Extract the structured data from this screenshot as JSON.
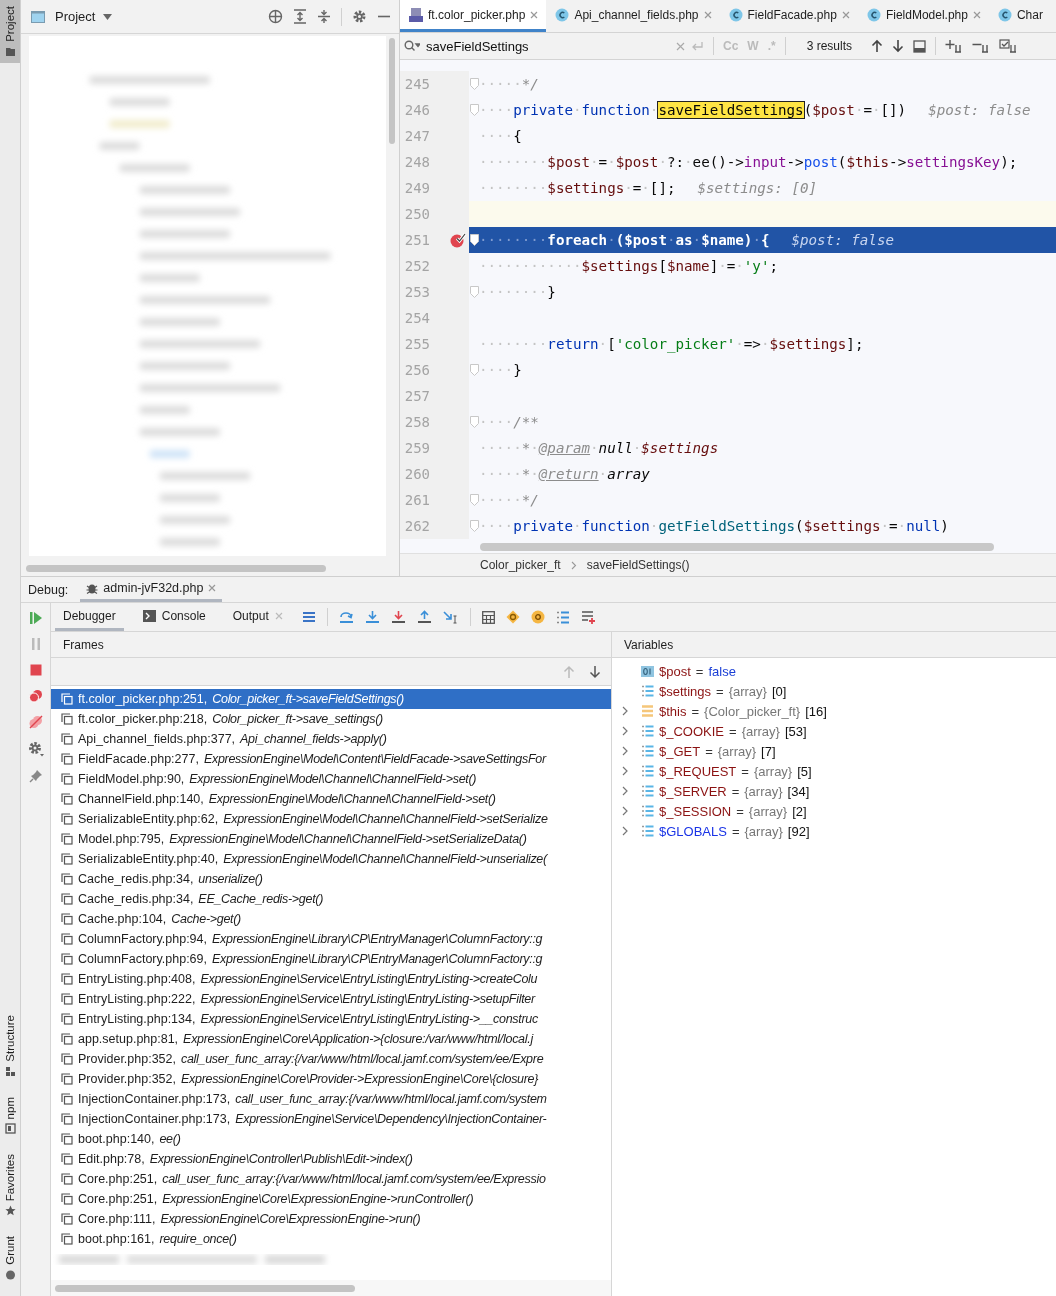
{
  "tool_strip": {
    "top": [
      {
        "label": "Project",
        "selected": true
      }
    ],
    "bottom": [
      {
        "label": "Structure",
        "kind": "structure"
      },
      {
        "label": "npm",
        "kind": "npm"
      },
      {
        "label": "Favorites",
        "kind": "star"
      },
      {
        "label": "Grunt",
        "kind": "grunt"
      }
    ]
  },
  "project_panel": {
    "title": "Project"
  },
  "editor_tabs": [
    {
      "label": "ft.color_picker.php",
      "kind": "php",
      "selected": true,
      "closable": true
    },
    {
      "label": "Api_channel_fields.php",
      "kind": "class",
      "selected": false,
      "closable": true
    },
    {
      "label": "FieldFacade.php",
      "kind": "class",
      "selected": false,
      "closable": true
    },
    {
      "label": "FieldModel.php",
      "kind": "class",
      "selected": false,
      "closable": true
    },
    {
      "label": "Char",
      "kind": "class",
      "selected": false,
      "closable": false
    }
  ],
  "search": {
    "value": "saveFieldSettings",
    "toggles": [
      "Cc",
      "W",
      ".*"
    ],
    "results": "3 results"
  },
  "code_lines": [
    {
      "number": "245",
      "fold": true,
      "current": false,
      "executing": false,
      "breakpoint": false,
      "tokens": [
        {
          "kind": "ws",
          "text": "·····"
        },
        {
          "kind": "comment",
          "text": "*/"
        }
      ]
    },
    {
      "number": "246",
      "fold": true,
      "current": false,
      "executing": false,
      "breakpoint": false,
      "tokens": [
        {
          "kind": "ws",
          "text": "····"
        },
        {
          "kind": "kw",
          "text": "private"
        },
        {
          "kind": "ws",
          "text": "·"
        },
        {
          "kind": "kw",
          "text": "function"
        },
        {
          "kind": "ws",
          "text": "·"
        },
        {
          "kind": "match",
          "text": "saveFieldSettings"
        },
        {
          "kind": "plain",
          "text": "("
        },
        {
          "kind": "var",
          "text": "$post"
        },
        {
          "kind": "ws",
          "text": "·"
        },
        {
          "kind": "plain",
          "text": "="
        },
        {
          "kind": "ws",
          "text": "·"
        },
        {
          "kind": "plain",
          "text": "[])"
        },
        {
          "kind": "hint",
          "text": "$post: false"
        }
      ]
    },
    {
      "number": "247",
      "fold": false,
      "current": false,
      "executing": false,
      "breakpoint": false,
      "tokens": [
        {
          "kind": "ws",
          "text": "····"
        },
        {
          "kind": "plain",
          "text": "{"
        }
      ]
    },
    {
      "number": "248",
      "fold": false,
      "current": false,
      "executing": false,
      "breakpoint": false,
      "tokens": [
        {
          "kind": "ws",
          "text": "········"
        },
        {
          "kind": "var",
          "text": "$post"
        },
        {
          "kind": "ws",
          "text": "·"
        },
        {
          "kind": "plain",
          "text": "="
        },
        {
          "kind": "ws",
          "text": "·"
        },
        {
          "kind": "var",
          "text": "$post"
        },
        {
          "kind": "ws",
          "text": "·"
        },
        {
          "kind": "plain",
          "text": "?:"
        },
        {
          "kind": "ws",
          "text": "·"
        },
        {
          "kind": "plain",
          "text": "ee()->"
        },
        {
          "kind": "prop",
          "text": "input"
        },
        {
          "kind": "plain",
          "text": "->"
        },
        {
          "kind": "call",
          "text": "post"
        },
        {
          "kind": "plain",
          "text": "("
        },
        {
          "kind": "var",
          "text": "$this"
        },
        {
          "kind": "plain",
          "text": "->"
        },
        {
          "kind": "prop",
          "text": "settingsKey"
        },
        {
          "kind": "plain",
          "text": ");"
        }
      ]
    },
    {
      "number": "249",
      "fold": false,
      "current": false,
      "executing": false,
      "breakpoint": false,
      "tokens": [
        {
          "kind": "ws",
          "text": "········"
        },
        {
          "kind": "var",
          "text": "$settings"
        },
        {
          "kind": "ws",
          "text": "·"
        },
        {
          "kind": "plain",
          "text": "="
        },
        {
          "kind": "ws",
          "text": "·"
        },
        {
          "kind": "plain",
          "text": "[];"
        },
        {
          "kind": "hint",
          "text": "$settings: [0]"
        }
      ]
    },
    {
      "number": "250",
      "fold": false,
      "current": true,
      "executing": false,
      "breakpoint": false
    },
    {
      "number": "251",
      "fold": true,
      "current": false,
      "executing": true,
      "breakpoint": true,
      "tokens": [
        {
          "kind": "ws",
          "text": "········"
        },
        {
          "kind": "kw",
          "text": "foreach"
        },
        {
          "kind": "ws",
          "text": "·"
        },
        {
          "kind": "plain",
          "text": "("
        },
        {
          "kind": "var",
          "text": "$post"
        },
        {
          "kind": "ws",
          "text": "·"
        },
        {
          "kind": "kw",
          "text": "as"
        },
        {
          "kind": "ws",
          "text": "·"
        },
        {
          "kind": "var",
          "text": "$name"
        },
        {
          "kind": "plain",
          "text": ")"
        },
        {
          "kind": "ws",
          "text": "·"
        },
        {
          "kind": "plain",
          "text": "{"
        },
        {
          "kind": "hint",
          "text": "$post: false"
        }
      ]
    },
    {
      "number": "252",
      "fold": false,
      "current": false,
      "executing": false,
      "breakpoint": false,
      "tokens": [
        {
          "kind": "ws",
          "text": "············"
        },
        {
          "kind": "var",
          "text": "$settings"
        },
        {
          "kind": "plain",
          "text": "["
        },
        {
          "kind": "var",
          "text": "$name"
        },
        {
          "kind": "plain",
          "text": "]"
        },
        {
          "kind": "ws",
          "text": "·"
        },
        {
          "kind": "plain",
          "text": "="
        },
        {
          "kind": "ws",
          "text": "·"
        },
        {
          "kind": "str",
          "text": "'y'"
        },
        {
          "kind": "plain",
          "text": ";"
        }
      ]
    },
    {
      "number": "253",
      "fold": true,
      "current": false,
      "executing": false,
      "breakpoint": false,
      "tokens": [
        {
          "kind": "ws",
          "text": "········"
        },
        {
          "kind": "plain",
          "text": "}"
        }
      ]
    },
    {
      "number": "254",
      "fold": false,
      "current": false,
      "executing": false,
      "breakpoint": false
    },
    {
      "number": "255",
      "fold": false,
      "current": false,
      "executing": false,
      "breakpoint": false,
      "tokens": [
        {
          "kind": "ws",
          "text": "········"
        },
        {
          "kind": "kw",
          "text": "return"
        },
        {
          "kind": "ws",
          "text": "·"
        },
        {
          "kind": "plain",
          "text": "["
        },
        {
          "kind": "str",
          "text": "'color_picker'"
        },
        {
          "kind": "ws",
          "text": "·"
        },
        {
          "kind": "plain",
          "text": "=>"
        },
        {
          "kind": "ws",
          "text": "·"
        },
        {
          "kind": "var",
          "text": "$settings"
        },
        {
          "kind": "plain",
          "text": "];"
        }
      ]
    },
    {
      "number": "256",
      "fold": true,
      "current": false,
      "executing": false,
      "breakpoint": false,
      "tokens": [
        {
          "kind": "ws",
          "text": "····"
        },
        {
          "kind": "plain",
          "text": "}"
        }
      ]
    },
    {
      "number": "257",
      "fold": false,
      "current": false,
      "executing": false,
      "breakpoint": false
    },
    {
      "number": "258",
      "fold": true,
      "current": false,
      "executing": false,
      "breakpoint": false,
      "tokens": [
        {
          "kind": "ws",
          "text": "····"
        },
        {
          "kind": "comment",
          "text": "/**"
        }
      ]
    },
    {
      "number": "259",
      "fold": false,
      "current": false,
      "executing": false,
      "breakpoint": false,
      "tokens": [
        {
          "kind": "ws",
          "text": "·····"
        },
        {
          "kind": "comment",
          "text": "*"
        },
        {
          "kind": "ws",
          "text": "·"
        },
        {
          "kind": "doctag",
          "text": "@param"
        },
        {
          "kind": "ws",
          "text": "·"
        },
        {
          "kind": "doctype",
          "text": "null"
        },
        {
          "kind": "ws",
          "text": "·"
        },
        {
          "kind": "docvar",
          "text": "$settings"
        }
      ]
    },
    {
      "number": "260",
      "fold": false,
      "current": false,
      "executing": false,
      "breakpoint": false,
      "tokens": [
        {
          "kind": "ws",
          "text": "·····"
        },
        {
          "kind": "comment",
          "text": "*"
        },
        {
          "kind": "ws",
          "text": "·"
        },
        {
          "kind": "doctag",
          "text": "@return"
        },
        {
          "kind": "ws",
          "text": "·"
        },
        {
          "kind": "doctype",
          "text": "array"
        }
      ]
    },
    {
      "number": "261",
      "fold": true,
      "current": false,
      "executing": false,
      "breakpoint": false,
      "tokens": [
        {
          "kind": "ws",
          "text": "·····"
        },
        {
          "kind": "comment",
          "text": "*/"
        }
      ]
    },
    {
      "number": "262",
      "fold": true,
      "current": false,
      "executing": false,
      "breakpoint": false,
      "tokens": [
        {
          "kind": "ws",
          "text": "····"
        },
        {
          "kind": "kw",
          "text": "private"
        },
        {
          "kind": "ws",
          "text": "·"
        },
        {
          "kind": "kw",
          "text": "function"
        },
        {
          "kind": "ws",
          "text": "·"
        },
        {
          "kind": "fn",
          "text": "getFieldSettings"
        },
        {
          "kind": "plain",
          "text": "("
        },
        {
          "kind": "var",
          "text": "$settings"
        },
        {
          "kind": "ws",
          "text": "·"
        },
        {
          "kind": "plain",
          "text": "="
        },
        {
          "kind": "ws",
          "text": "·"
        },
        {
          "kind": "kw",
          "text": "null"
        },
        {
          "kind": "plain",
          "text": ")"
        }
      ]
    }
  ],
  "breadcrumbs": [
    "Color_picker_ft",
    "saveFieldSettings()"
  ],
  "debug": {
    "label": "Debug:",
    "session": "admin-jvF32d.php",
    "tabs": [
      {
        "label": "Debugger",
        "kind": "plain",
        "selected": true,
        "closable": false
      },
      {
        "label": "Console",
        "kind": "console",
        "selected": false,
        "closable": false
      },
      {
        "label": "Output",
        "kind": "plain",
        "selected": false,
        "closable": true
      }
    ]
  },
  "frames": {
    "title": "Frames",
    "rows": [
      {
        "file": "ft.color_picker.php:251,",
        "method": "Color_picker_ft->saveFieldSettings()",
        "selected": true
      },
      {
        "file": "ft.color_picker.php:218,",
        "method": "Color_picker_ft->save_settings()",
        "selected": false
      },
      {
        "file": "Api_channel_fields.php:377,",
        "method": "Api_channel_fields->apply()",
        "selected": false
      },
      {
        "file": "FieldFacade.php:277,",
        "method": "ExpressionEngine\\Model\\Content\\FieldFacade->saveSettingsFor",
        "selected": false
      },
      {
        "file": "FieldModel.php:90,",
        "method": "ExpressionEngine\\Model\\Channel\\ChannelField->set()",
        "selected": false
      },
      {
        "file": "ChannelField.php:140,",
        "method": "ExpressionEngine\\Model\\Channel\\ChannelField->set()",
        "selected": false
      },
      {
        "file": "SerializableEntity.php:62,",
        "method": "ExpressionEngine\\Model\\Channel\\ChannelField->setSerialize",
        "selected": false
      },
      {
        "file": "Model.php:795,",
        "method": "ExpressionEngine\\Model\\Channel\\ChannelField->setSerializeData()",
        "selected": false
      },
      {
        "file": "SerializableEntity.php:40,",
        "method": "ExpressionEngine\\Model\\Channel\\ChannelField->unserialize(",
        "selected": false
      },
      {
        "file": "Cache_redis.php:34,",
        "method": "unserialize()",
        "selected": false
      },
      {
        "file": "Cache_redis.php:34,",
        "method": "EE_Cache_redis->get()",
        "selected": false
      },
      {
        "file": "Cache.php:104,",
        "method": "Cache->get()",
        "selected": false
      },
      {
        "file": "ColumnFactory.php:94,",
        "method": "ExpressionEngine\\Library\\CP\\EntryManager\\ColumnFactory::g",
        "selected": false
      },
      {
        "file": "ColumnFactory.php:69,",
        "method": "ExpressionEngine\\Library\\CP\\EntryManager\\ColumnFactory::g",
        "selected": false
      },
      {
        "file": "EntryListing.php:408,",
        "method": "ExpressionEngine\\Service\\EntryListing\\EntryListing->createColu",
        "selected": false
      },
      {
        "file": "EntryListing.php:222,",
        "method": "ExpressionEngine\\Service\\EntryListing\\EntryListing->setupFilter",
        "selected": false
      },
      {
        "file": "EntryListing.php:134,",
        "method": "ExpressionEngine\\Service\\EntryListing\\EntryListing->__construc",
        "selected": false
      },
      {
        "file": "app.setup.php:81,",
        "method": "ExpressionEngine\\Core\\Application->{closure:/var/www/html/local.j",
        "selected": false
      },
      {
        "file": "Provider.php:352,",
        "method": "call_user_func_array:{/var/www/html/local.jamf.com/system/ee/Expre",
        "selected": false
      },
      {
        "file": "Provider.php:352,",
        "method": "ExpressionEngine\\Core\\Provider->ExpressionEngine\\Core\\{closure}",
        "selected": false
      },
      {
        "file": "InjectionContainer.php:173,",
        "method": "call_user_func_array:{/var/www/html/local.jamf.com/system",
        "selected": false
      },
      {
        "file": "InjectionContainer.php:173,",
        "method": "ExpressionEngine\\Service\\Dependency\\InjectionContainer-",
        "selected": false
      },
      {
        "file": "boot.php:140,",
        "method": "ee()",
        "selected": false
      },
      {
        "file": "Edit.php:78,",
        "method": "ExpressionEngine\\Controller\\Publish\\Edit->index()",
        "selected": false
      },
      {
        "file": "Core.php:251,",
        "method": "call_user_func_array:{/var/www/html/local.jamf.com/system/ee/Expressio",
        "selected": false
      },
      {
        "file": "Core.php:251,",
        "method": "ExpressionEngine\\Core\\ExpressionEngine->runController()",
        "selected": false
      },
      {
        "file": "Core.php:111,",
        "method": "ExpressionEngine\\Core\\ExpressionEngine->run()",
        "selected": false
      },
      {
        "file": "boot.php:161,",
        "method": "require_once()",
        "selected": false
      }
    ]
  },
  "variables": {
    "title": "Variables",
    "rows": [
      {
        "name": "$post",
        "separator": "=",
        "value": "false",
        "kind": "bool",
        "expandable": false,
        "global": false
      },
      {
        "name": "$settings",
        "separator": "=",
        "value_type": "{array}",
        "value": "[0]",
        "kind": "array",
        "expandable": false,
        "global": false
      },
      {
        "name": "$this",
        "separator": "=",
        "value_type": "{Color_picker_ft}",
        "value": "[16]",
        "kind": "object",
        "expandable": true,
        "global": false
      },
      {
        "name": "$_COOKIE",
        "separator": "=",
        "value_type": "{array}",
        "value": "[53]",
        "kind": "array",
        "expandable": true,
        "global": false
      },
      {
        "name": "$_GET",
        "separator": "=",
        "value_type": "{array}",
        "value": "[7]",
        "kind": "array",
        "expandable": true,
        "global": false
      },
      {
        "name": "$_REQUEST",
        "separator": "=",
        "value_type": "{array}",
        "value": "[5]",
        "kind": "array",
        "expandable": true,
        "global": false
      },
      {
        "name": "$_SERVER",
        "separator": "=",
        "value_type": "{array}",
        "value": "[34]",
        "kind": "array",
        "expandable": true,
        "global": false
      },
      {
        "name": "$_SESSION",
        "separator": "=",
        "value_type": "{array}",
        "value": "[2]",
        "kind": "array",
        "expandable": true,
        "global": false
      },
      {
        "name": "$GLOBALS",
        "separator": "=",
        "value_type": "{array}",
        "value": "[92]",
        "kind": "array",
        "expandable": true,
        "global": true
      }
    ]
  }
}
